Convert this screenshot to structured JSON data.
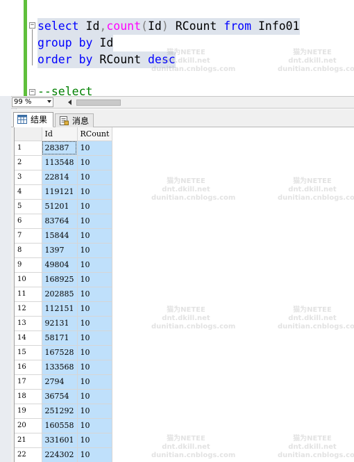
{
  "editor": {
    "lines": [
      {
        "parts": [
          {
            "t": "select",
            "c": "kw"
          },
          {
            "t": " Id",
            "c": ""
          },
          {
            "t": ",",
            "c": "gr"
          },
          {
            "t": "count",
            "c": "fn"
          },
          {
            "t": "(",
            "c": "gr"
          },
          {
            "t": "Id",
            "c": ""
          },
          {
            "t": ")",
            "c": "gr"
          },
          {
            "t": " RCount ",
            "c": ""
          },
          {
            "t": "from",
            "c": "kw"
          },
          {
            "t": " Info01",
            "c": ""
          }
        ]
      },
      {
        "parts": [
          {
            "t": "group by",
            "c": "kw"
          },
          {
            "t": " Id",
            "c": ""
          }
        ]
      },
      {
        "parts": [
          {
            "t": "order by",
            "c": "kw"
          },
          {
            "t": " RCount ",
            "c": ""
          },
          {
            "t": "desc",
            "c": "kw"
          }
        ]
      },
      {
        "parts": [
          {
            "t": "--select",
            "c": "cm"
          }
        ]
      }
    ]
  },
  "zoom": {
    "value": "99 %"
  },
  "tabs": {
    "results_label": "结果",
    "messages_label": "消息"
  },
  "grid": {
    "columns": [
      "Id",
      "RCount"
    ],
    "rows": [
      [
        "1",
        "28387",
        "10"
      ],
      [
        "2",
        "113548",
        "10"
      ],
      [
        "3",
        "22814",
        "10"
      ],
      [
        "4",
        "119121",
        "10"
      ],
      [
        "5",
        "51201",
        "10"
      ],
      [
        "6",
        "83764",
        "10"
      ],
      [
        "7",
        "15844",
        "10"
      ],
      [
        "8",
        "1397",
        "10"
      ],
      [
        "9",
        "49804",
        "10"
      ],
      [
        "10",
        "168925",
        "10"
      ],
      [
        "11",
        "202885",
        "10"
      ],
      [
        "12",
        "112151",
        "10"
      ],
      [
        "13",
        "92131",
        "10"
      ],
      [
        "14",
        "58171",
        "10"
      ],
      [
        "15",
        "167528",
        "10"
      ],
      [
        "16",
        "133568",
        "10"
      ],
      [
        "17",
        "2794",
        "10"
      ],
      [
        "18",
        "36754",
        "10"
      ],
      [
        "19",
        "251292",
        "10"
      ],
      [
        "20",
        "160558",
        "10"
      ],
      [
        "21",
        "331601",
        "10"
      ],
      [
        "22",
        "224302",
        "10"
      ]
    ]
  },
  "watermark": {
    "line1": "猫为NETEE",
    "line2": "dnt.dkill.net",
    "line3": "dunitian.cnblogs.com"
  },
  "colors": {
    "keyword": "#0000ff",
    "function": "#ff00ff",
    "comment": "#008000",
    "selection": "#bfe0fb"
  },
  "icons": {
    "results": "grid-icon",
    "messages": "document-icon"
  }
}
